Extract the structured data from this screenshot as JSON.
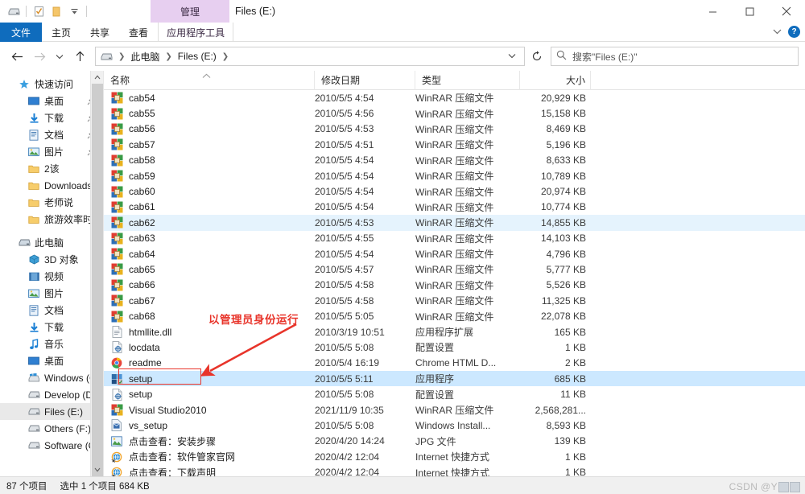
{
  "window": {
    "title": "Files (E:)",
    "management_tab": "管理",
    "minimize": "—",
    "maximize": "□",
    "close": "✕",
    "quick_access_icons": [
      "drive-icon",
      "properties-icon",
      "new-folder-icon",
      "customize-chevron-icon"
    ]
  },
  "ribbon": {
    "tabs": [
      {
        "label": "文件",
        "name": "tab-file",
        "active": true
      },
      {
        "label": "主页",
        "name": "tab-home",
        "active": false
      },
      {
        "label": "共享",
        "name": "tab-share",
        "active": false
      },
      {
        "label": "查看",
        "name": "tab-view",
        "active": false
      },
      {
        "label": "应用程序工具",
        "name": "tab-app-tools",
        "active": false
      }
    ],
    "collapse_icon": "chevron-down-icon",
    "help_icon": "?"
  },
  "address": {
    "back": "←",
    "forward": "→",
    "recent": "˅",
    "up": "↑",
    "crumbs": [
      "此电脑",
      "Files (E:)"
    ],
    "trailing_sep": "›",
    "drive_icon": "drive-icon",
    "dropdown": "˅",
    "refresh": "↻"
  },
  "search": {
    "icon": "search-icon",
    "placeholder": "搜索\"Files (E:)\""
  },
  "sidebar": {
    "groups": [
      {
        "name": "快速访问",
        "icon": "star-icon",
        "items": [
          {
            "label": "桌面",
            "icon": "desktop-icon",
            "pinned": true
          },
          {
            "label": "下载",
            "icon": "download-icon",
            "pinned": true
          },
          {
            "label": "文档",
            "icon": "document-icon",
            "pinned": true
          },
          {
            "label": "图片",
            "icon": "pictures-icon",
            "pinned": true
          },
          {
            "label": "2该",
            "icon": "folder-icon",
            "pinned": false
          },
          {
            "label": "Downloads",
            "icon": "folder-icon",
            "pinned": false
          },
          {
            "label": "老师说",
            "icon": "folder-icon",
            "pinned": false
          },
          {
            "label": "旅游效率时空演化",
            "icon": "folder-icon",
            "pinned": false
          }
        ]
      },
      {
        "name": "此电脑",
        "icon": "this-pc-icon",
        "items": [
          {
            "label": "3D 对象",
            "icon": "3d-objects-icon",
            "pinned": false
          },
          {
            "label": "视频",
            "icon": "videos-icon",
            "pinned": false
          },
          {
            "label": "图片",
            "icon": "pictures-icon",
            "pinned": false
          },
          {
            "label": "文档",
            "icon": "document-icon",
            "pinned": false
          },
          {
            "label": "下载",
            "icon": "download-icon",
            "pinned": false
          },
          {
            "label": "音乐",
            "icon": "music-icon",
            "pinned": false
          },
          {
            "label": "桌面",
            "icon": "desktop-icon",
            "pinned": false
          },
          {
            "label": "Windows (C:)",
            "icon": "windows-drive-icon",
            "pinned": false
          },
          {
            "label": "Develop (D:)",
            "icon": "drive-icon",
            "pinned": false
          },
          {
            "label": "Files (E:)",
            "icon": "drive-icon",
            "pinned": false,
            "selected": true
          },
          {
            "label": "Others (F:)",
            "icon": "drive-icon",
            "pinned": false
          },
          {
            "label": "Software (G:)",
            "icon": "drive-icon",
            "pinned": false
          }
        ]
      }
    ]
  },
  "columns": {
    "name": "名称",
    "date": "修改日期",
    "type": "类型",
    "size": "大小",
    "sort_caret": "︿"
  },
  "files": [
    {
      "name": "cab54",
      "date": "2010/5/5 4:54",
      "type": "WinRAR 压缩文件",
      "size": "20,929 KB",
      "icon": "winrar-icon",
      "state": ""
    },
    {
      "name": "cab55",
      "date": "2010/5/5 4:56",
      "type": "WinRAR 压缩文件",
      "size": "15,158 KB",
      "icon": "winrar-icon",
      "state": ""
    },
    {
      "name": "cab56",
      "date": "2010/5/5 4:53",
      "type": "WinRAR 压缩文件",
      "size": "8,469 KB",
      "icon": "winrar-icon",
      "state": ""
    },
    {
      "name": "cab57",
      "date": "2010/5/5 4:51",
      "type": "WinRAR 压缩文件",
      "size": "5,196 KB",
      "icon": "winrar-icon",
      "state": ""
    },
    {
      "name": "cab58",
      "date": "2010/5/5 4:54",
      "type": "WinRAR 压缩文件",
      "size": "8,633 KB",
      "icon": "winrar-icon",
      "state": ""
    },
    {
      "name": "cab59",
      "date": "2010/5/5 4:54",
      "type": "WinRAR 压缩文件",
      "size": "10,789 KB",
      "icon": "winrar-icon",
      "state": ""
    },
    {
      "name": "cab60",
      "date": "2010/5/5 4:54",
      "type": "WinRAR 压缩文件",
      "size": "20,974 KB",
      "icon": "winrar-icon",
      "state": ""
    },
    {
      "name": "cab61",
      "date": "2010/5/5 4:54",
      "type": "WinRAR 压缩文件",
      "size": "10,774 KB",
      "icon": "winrar-icon",
      "state": ""
    },
    {
      "name": "cab62",
      "date": "2010/5/5 4:53",
      "type": "WinRAR 压缩文件",
      "size": "14,855 KB",
      "icon": "winrar-icon",
      "state": "hl"
    },
    {
      "name": "cab63",
      "date": "2010/5/5 4:55",
      "type": "WinRAR 压缩文件",
      "size": "14,103 KB",
      "icon": "winrar-icon",
      "state": ""
    },
    {
      "name": "cab64",
      "date": "2010/5/5 4:54",
      "type": "WinRAR 压缩文件",
      "size": "4,796 KB",
      "icon": "winrar-icon",
      "state": ""
    },
    {
      "name": "cab65",
      "date": "2010/5/5 4:57",
      "type": "WinRAR 压缩文件",
      "size": "5,777 KB",
      "icon": "winrar-icon",
      "state": ""
    },
    {
      "name": "cab66",
      "date": "2010/5/5 4:58",
      "type": "WinRAR 压缩文件",
      "size": "5,526 KB",
      "icon": "winrar-icon",
      "state": ""
    },
    {
      "name": "cab67",
      "date": "2010/5/5 4:58",
      "type": "WinRAR 压缩文件",
      "size": "11,325 KB",
      "icon": "winrar-icon",
      "state": ""
    },
    {
      "name": "cab68",
      "date": "2010/5/5 5:05",
      "type": "WinRAR 压缩文件",
      "size": "22,078 KB",
      "icon": "winrar-icon",
      "state": ""
    },
    {
      "name": "htmllite.dll",
      "date": "2010/3/19 10:51",
      "type": "应用程序扩展",
      "size": "165 KB",
      "icon": "dll-icon",
      "state": ""
    },
    {
      "name": "locdata",
      "date": "2010/5/5 5:08",
      "type": "配置设置",
      "size": "1 KB",
      "icon": "config-icon",
      "state": ""
    },
    {
      "name": "readme",
      "date": "2010/5/4 16:19",
      "type": "Chrome HTML D...",
      "size": "2 KB",
      "icon": "chrome-icon",
      "state": ""
    },
    {
      "name": "setup",
      "date": "2010/5/5 5:11",
      "type": "应用程序",
      "size": "685 KB",
      "icon": "application-icon",
      "state": "sel"
    },
    {
      "name": "setup",
      "date": "2010/5/5 5:08",
      "type": "配置设置",
      "size": "11 KB",
      "icon": "config-icon",
      "state": ""
    },
    {
      "name": "Visual Studio2010",
      "date": "2021/11/9 10:35",
      "type": "WinRAR 压缩文件",
      "size": "2,568,281...",
      "icon": "winrar-icon",
      "state": ""
    },
    {
      "name": "vs_setup",
      "date": "2010/5/5 5:08",
      "type": "Windows Install...",
      "size": "8,593 KB",
      "icon": "msi-icon",
      "state": ""
    },
    {
      "name": "点击查看：安装步骤",
      "date": "2020/4/20 14:24",
      "type": "JPG 文件",
      "size": "139 KB",
      "icon": "jpg-icon",
      "state": ""
    },
    {
      "name": "点击查看：软件管家官网",
      "date": "2020/4/2 12:04",
      "type": "Internet 快捷方式",
      "size": "1 KB",
      "icon": "internet-shortcut-icon",
      "state": ""
    },
    {
      "name": "点击查看：下载声明",
      "date": "2020/4/2 12:04",
      "type": "Internet 快捷方式",
      "size": "1 KB",
      "icon": "internet-shortcut-icon",
      "state": ""
    }
  ],
  "annotation": {
    "text": "以管理员身份运行",
    "color": "#e8342a",
    "highlight_target": "setup"
  },
  "statusbar": {
    "item_count": "87 个项目",
    "selection": "选中 1 个项目  684 KB"
  },
  "watermark": {
    "text": "CSDN @Y"
  }
}
